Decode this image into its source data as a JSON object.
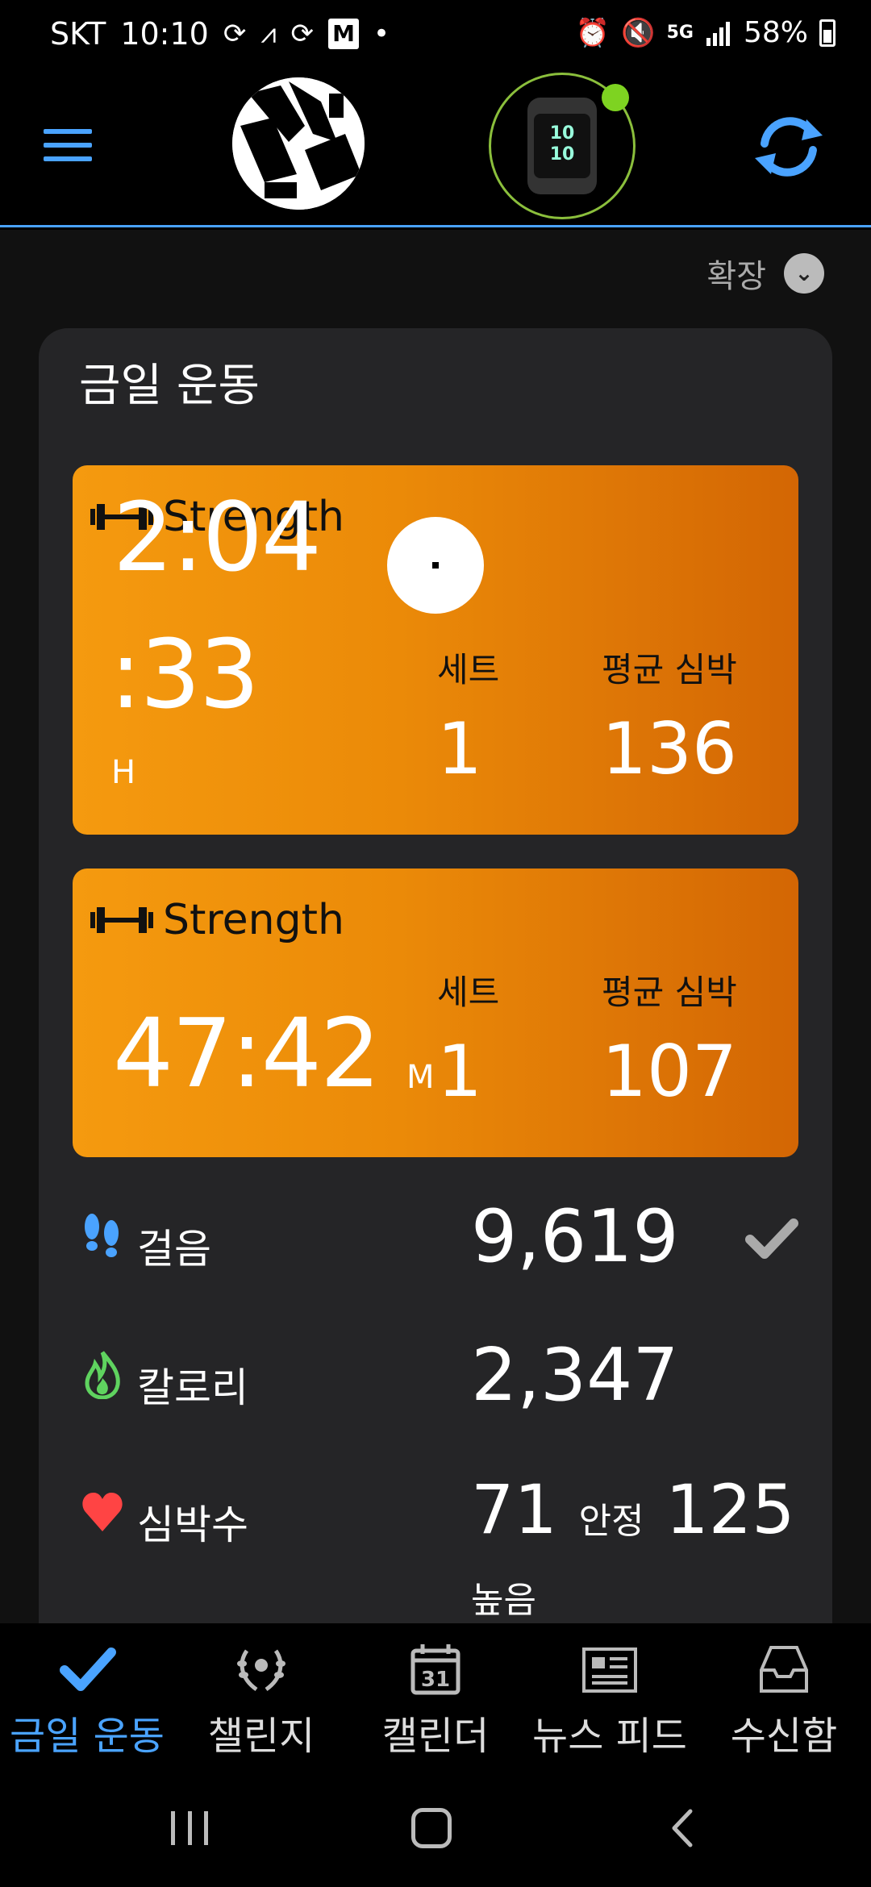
{
  "status_bar": {
    "carrier": "SKT",
    "time": "10:10",
    "battery": "58%",
    "network": "5G"
  },
  "app_bar": {
    "watch_face_lines": [
      "10",
      "10"
    ]
  },
  "expand_label": "확장",
  "panel_title": "금일 운동",
  "activities": [
    {
      "name": "Strength",
      "time_line1": "2:04",
      "time_line2": ":33",
      "time_unit": "H",
      "sets_label": "세트",
      "sets_value": "1",
      "hr_label": "평균 심박",
      "hr_value": "136"
    },
    {
      "name": "Strength",
      "time": "47:42",
      "time_unit": "M",
      "sets_label": "세트",
      "sets_value": "1",
      "hr_label": "평균 심박",
      "hr_value": "107"
    }
  ],
  "metrics": {
    "steps": {
      "label": "걸음",
      "value": "9,619",
      "color": "#4aa3ff"
    },
    "calories": {
      "label": "칼로리",
      "value": "2,347",
      "color": "#5fd35f"
    },
    "heart_rate": {
      "label": "심박수",
      "resting_value": "71",
      "resting_label": "안정",
      "high_value": "125",
      "high_label": "높음",
      "color": "#f44"
    }
  },
  "bottom_nav": [
    {
      "label": "금일 운동",
      "icon": "check-icon",
      "active": true
    },
    {
      "label": "챌린지",
      "icon": "laurel-icon",
      "active": false
    },
    {
      "label": "캘린더",
      "icon": "calendar-icon",
      "calendar_day": "31",
      "active": false
    },
    {
      "label": "뉴스 피드",
      "icon": "news-icon",
      "active": false
    },
    {
      "label": "수신함",
      "icon": "inbox-icon",
      "active": false
    }
  ],
  "colors": {
    "accent": "#4aa3ff",
    "activity_orange": "#f59a0f",
    "watch_ring": "#8bbf3c"
  }
}
